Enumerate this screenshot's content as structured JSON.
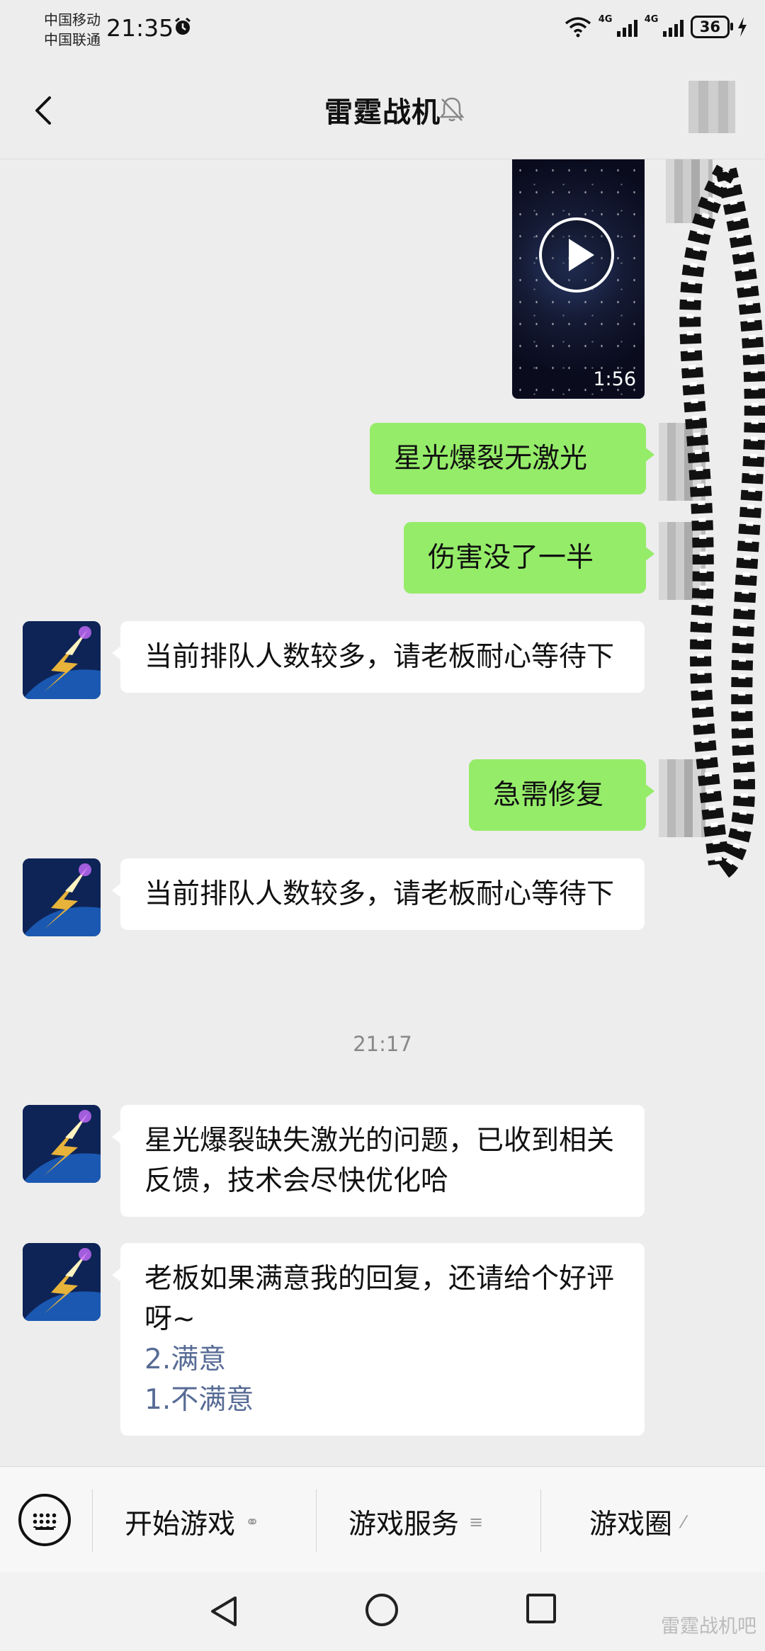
{
  "status_bar": {
    "carrier_1": "中国移动",
    "carrier_2": "中国联通",
    "time": "21:35",
    "network_1": "4G",
    "network_2": "4G",
    "battery": "36"
  },
  "header": {
    "title": "雷霆战机"
  },
  "video": {
    "duration": "1:56"
  },
  "messages": {
    "m1": "星光爆裂无激光",
    "m2": "伤害没了一半",
    "m3": "当前排队人数较多，请老板耐心等待下",
    "m4": "急需修复",
    "m5": "当前排队人数较多，请老板耐心等待下",
    "timestamp": "21:17",
    "m6": "星光爆裂缺失激光的问题，已收到相关反馈，技术会尽快优化哈",
    "m7_text": "老板如果满意我的回复，还请给个好评呀~",
    "m7_option_1": "2.满意",
    "m7_option_2": "1.不满意"
  },
  "bottom_menu": {
    "item_1": "开始游戏",
    "item_2": "游戏服务",
    "item_3": "游戏圈"
  },
  "watermark": "雷霆战机吧",
  "colors": {
    "outgoing_bubble": "#95ec69",
    "incoming_bubble": "#ffffff",
    "chat_background": "#ededed",
    "link_option": "#576b95"
  }
}
